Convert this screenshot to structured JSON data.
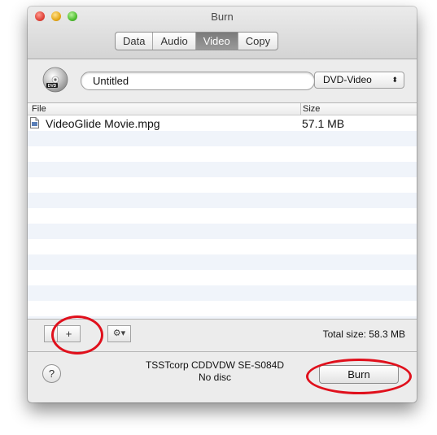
{
  "window": {
    "title": "Burn"
  },
  "tabs": [
    {
      "label": "Data",
      "active": false
    },
    {
      "label": "Audio",
      "active": false
    },
    {
      "label": "Video",
      "active": true
    },
    {
      "label": "Copy",
      "active": false
    }
  ],
  "disc": {
    "name_value": "Untitled",
    "format": "DVD-Video",
    "icon": "dvd-disc-icon"
  },
  "table": {
    "columns": [
      "File",
      "Size"
    ],
    "rows": [
      {
        "file": "VideoGlide Movie.mpg",
        "size": "57.1 MB"
      }
    ]
  },
  "toolbar": {
    "add_label": "+",
    "gear_label": "⚙▾"
  },
  "total_size": "Total size: 58.3 MB",
  "drive": {
    "name": "TSSTcorp CDDVDW SE-S084D",
    "status": "No disc"
  },
  "help_label": "?",
  "burn_label": "Burn",
  "colors": {
    "annotation": "#e0101c",
    "selected_tab": "#8a8a8a",
    "stripe": "#f0f4fa"
  }
}
